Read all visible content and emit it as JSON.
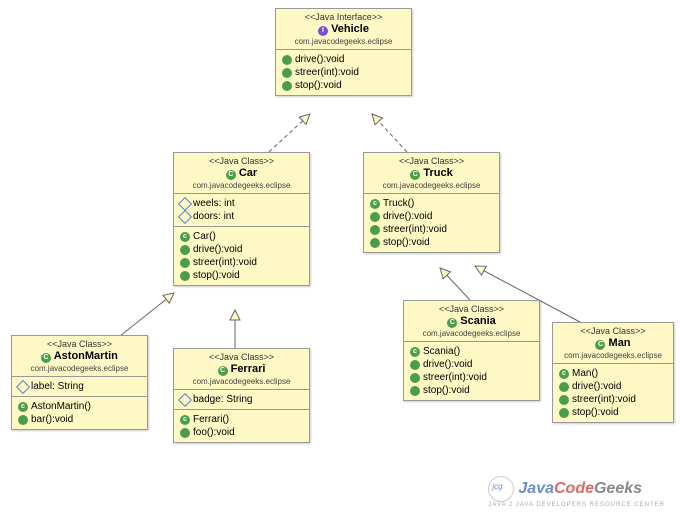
{
  "stereo_interface": "<<Java Interface>>",
  "stereo_class": "<<Java Class>>",
  "pkg": "com.javacodegeeks.eclipse",
  "vehicle": {
    "name": "Vehicle",
    "m1": "drive():void",
    "m2": "streer(int):void",
    "m3": "stop():void"
  },
  "car": {
    "name": "Car",
    "a1": "weels: int",
    "a2": "doors: int",
    "c1": "Car()",
    "m1": "drive():void",
    "m2": "streer(int):void",
    "m3": "stop():void"
  },
  "truck": {
    "name": "Truck",
    "c1": "Truck()",
    "m1": "drive():void",
    "m2": "streer(int):void",
    "m3": "stop():void"
  },
  "aston": {
    "name": "AstonMartin",
    "a1": "label: String",
    "c1": "AstonMartin()",
    "m1": "bar():void"
  },
  "ferrari": {
    "name": "Ferrari",
    "a1": "badge: String",
    "c1": "Ferrari()",
    "m1": "foo():void"
  },
  "scania": {
    "name": "Scania",
    "c1": "Scania()",
    "m1": "drive():void",
    "m2": "streer(int):void",
    "m3": "stop():void"
  },
  "man": {
    "name": "Man",
    "c1": "Man()",
    "m1": "drive():void",
    "m2": "streer(int):void",
    "m3": "stop():void"
  },
  "wm": {
    "j": "Java",
    "c": "Code",
    "g": "Geeks",
    "sub": "JAVA 2 JAVA DEVELOPERS RESOURCE CENTER"
  }
}
